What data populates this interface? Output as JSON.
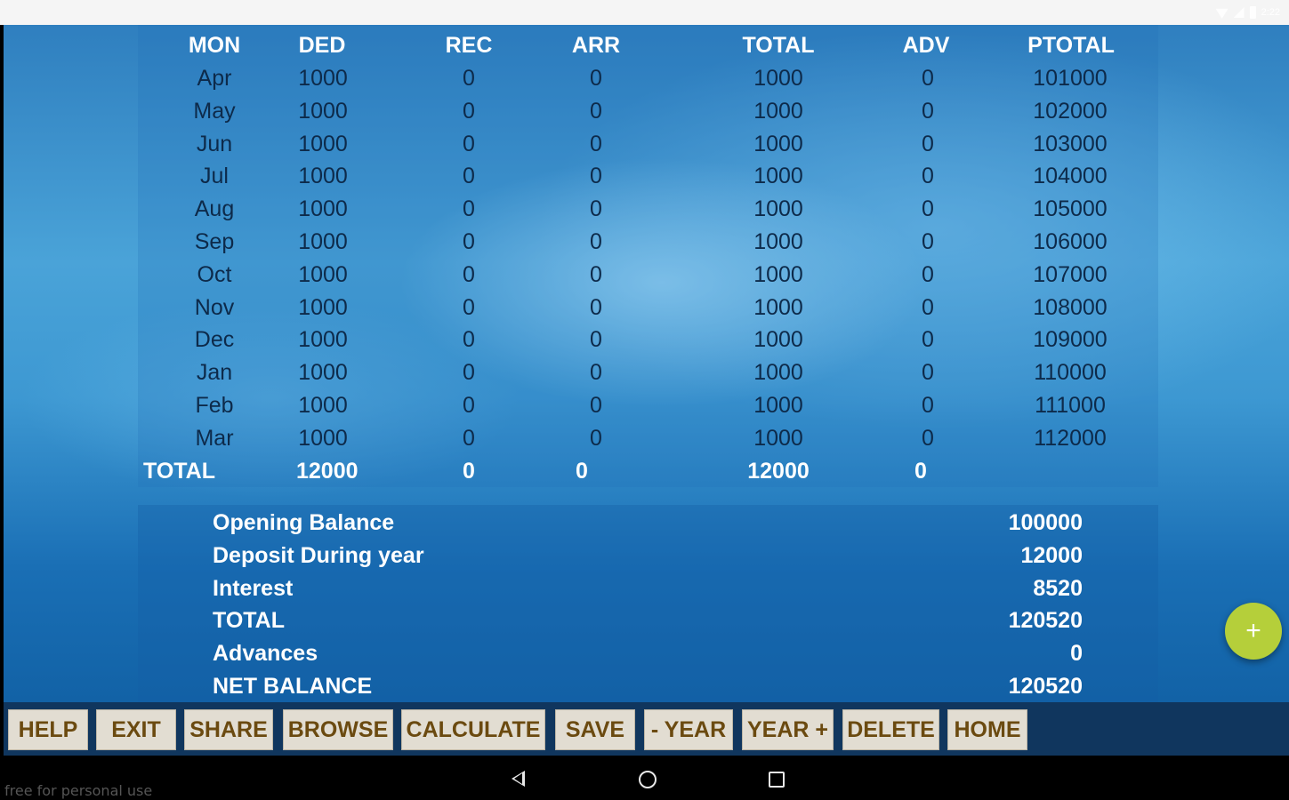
{
  "status_bar": {
    "clock": "2:22"
  },
  "table": {
    "headers": [
      "MON",
      "DED",
      "REC",
      "ARR",
      "TOTAL",
      "ADV",
      "PTOTAL"
    ],
    "rows": [
      {
        "mon": "Apr",
        "ded": "1000",
        "rec": "0",
        "arr": "0",
        "total": "1000",
        "adv": "0",
        "ptotal": "101000"
      },
      {
        "mon": "May",
        "ded": "1000",
        "rec": "0",
        "arr": "0",
        "total": "1000",
        "adv": "0",
        "ptotal": "102000"
      },
      {
        "mon": "Jun",
        "ded": "1000",
        "rec": "0",
        "arr": "0",
        "total": "1000",
        "adv": "0",
        "ptotal": "103000"
      },
      {
        "mon": "Jul",
        "ded": "1000",
        "rec": "0",
        "arr": "0",
        "total": "1000",
        "adv": "0",
        "ptotal": "104000"
      },
      {
        "mon": "Aug",
        "ded": "1000",
        "rec": "0",
        "arr": "0",
        "total": "1000",
        "adv": "0",
        "ptotal": "105000"
      },
      {
        "mon": "Sep",
        "ded": "1000",
        "rec": "0",
        "arr": "0",
        "total": "1000",
        "adv": "0",
        "ptotal": "106000"
      },
      {
        "mon": "Oct",
        "ded": "1000",
        "rec": "0",
        "arr": "0",
        "total": "1000",
        "adv": "0",
        "ptotal": "107000"
      },
      {
        "mon": "Nov",
        "ded": "1000",
        "rec": "0",
        "arr": "0",
        "total": "1000",
        "adv": "0",
        "ptotal": "108000"
      },
      {
        "mon": "Dec",
        "ded": "1000",
        "rec": "0",
        "arr": "0",
        "total": "1000",
        "adv": "0",
        "ptotal": "109000"
      },
      {
        "mon": "Jan",
        "ded": "1000",
        "rec": "0",
        "arr": "0",
        "total": "1000",
        "adv": "0",
        "ptotal": "110000"
      },
      {
        "mon": "Feb",
        "ded": "1000",
        "rec": "0",
        "arr": "0",
        "total": "1000",
        "adv": "0",
        "ptotal": "111000"
      },
      {
        "mon": "Mar",
        "ded": "1000",
        "rec": "0",
        "arr": "0",
        "total": "1000",
        "adv": "0",
        "ptotal": "112000"
      }
    ],
    "total_row": {
      "label": "TOTAL",
      "ded": "12000",
      "rec": "0",
      "arr": "0",
      "total": "12000",
      "adv": "0"
    }
  },
  "summary": [
    {
      "label": "Opening Balance",
      "value": "100000"
    },
    {
      "label": "Deposit During year",
      "value": "12000"
    },
    {
      "label": "Interest",
      "value": "8520"
    },
    {
      "label": "TOTAL",
      "value": "120520"
    },
    {
      "label": "Advances",
      "value": "0"
    },
    {
      "label": "NET BALANCE",
      "value": "120520"
    }
  ],
  "fab": {
    "label": "+",
    "icon": "plus-icon",
    "color": "#b5cf3a"
  },
  "toolbar": {
    "buttons": [
      "HELP",
      "EXIT",
      "SHARE",
      "BROWSE",
      "CALCULATE",
      "SAVE",
      "- YEAR",
      "YEAR +",
      "DELETE",
      "HOME"
    ]
  },
  "nav_bar": {
    "icons": [
      "back-icon",
      "home-circle-icon",
      "recents-icon"
    ]
  },
  "watermark": "free for personal use",
  "colors": {
    "header_text": "#ffffff",
    "row_text": "#0d2a4a",
    "button_bg": "#e2ddd2",
    "button_text": "#6b4a10",
    "toolbar_bg": "#10365e"
  }
}
